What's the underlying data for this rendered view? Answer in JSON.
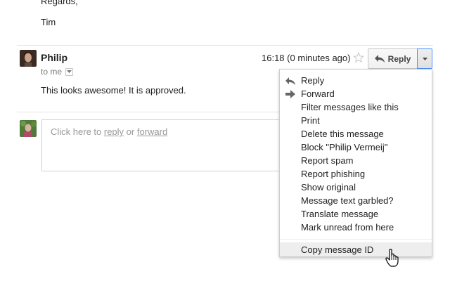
{
  "previous_message": {
    "regards": "Regards,",
    "signoff": "Tim"
  },
  "message": {
    "sender": "Philip",
    "recipient": "to me",
    "time": "16:18 (0 minutes ago)",
    "body": "This looks awesome! It is approved."
  },
  "actions": {
    "reply_label": "Reply"
  },
  "reply_box": {
    "prefix": "Click here to ",
    "reply_link": "reply",
    "or": " or ",
    "forward_link": "forward"
  },
  "menu": {
    "items": [
      {
        "label": "Reply",
        "icon": "reply-arrow-icon"
      },
      {
        "label": "Forward",
        "icon": "forward-arrow-icon"
      },
      {
        "label": "Filter messages like this"
      },
      {
        "label": "Print"
      },
      {
        "label": "Delete this message"
      },
      {
        "label": "Block \"Philip Vermeij\""
      },
      {
        "label": "Report spam"
      },
      {
        "label": "Report phishing"
      },
      {
        "label": "Show original"
      },
      {
        "label": "Message text garbled?"
      },
      {
        "label": "Translate message"
      },
      {
        "label": "Mark unread from here"
      }
    ],
    "copy_id": "Copy message ID"
  },
  "colors": {
    "accent_border": "#4d90fe",
    "menu_hover": "#eeeeee",
    "muted_text": "#777777",
    "placeholder_text": "#999999"
  }
}
